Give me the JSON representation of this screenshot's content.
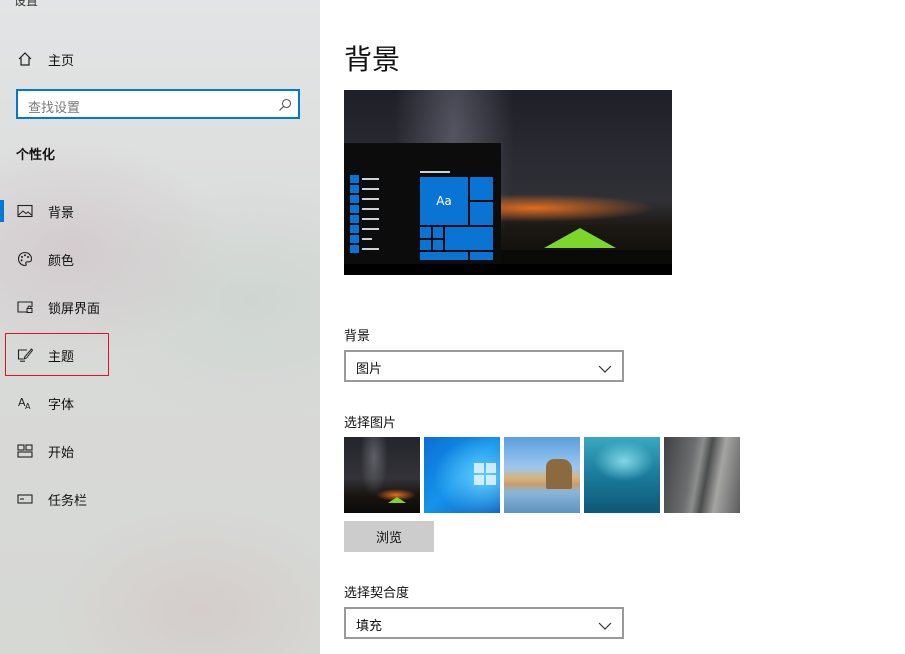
{
  "app_title": "设置",
  "sidebar": {
    "home_label": "主页",
    "search_placeholder": "查找设置",
    "section_title": "个性化",
    "items": [
      {
        "label": "背景",
        "icon": "picture-icon"
      },
      {
        "label": "颜色",
        "icon": "palette-icon"
      },
      {
        "label": "锁屏界面",
        "icon": "lock-screen-icon"
      },
      {
        "label": "主题",
        "icon": "theme-brush-icon"
      },
      {
        "label": "字体",
        "icon": "font-icon"
      },
      {
        "label": "开始",
        "icon": "start-grid-icon"
      },
      {
        "label": "任务栏",
        "icon": "taskbar-icon"
      }
    ],
    "active_item": "背景",
    "highlighted_item": "主题"
  },
  "main": {
    "page_title": "背景",
    "preview": {
      "tile_text": "Aa"
    },
    "background_label": "背景",
    "background_value": "图片",
    "choose_picture_label": "选择图片",
    "browse_label": "浏览",
    "fit_label": "选择契合度",
    "fit_value": "填充"
  },
  "colors": {
    "accent": "#0078d7",
    "highlight_border": "#e81123"
  }
}
